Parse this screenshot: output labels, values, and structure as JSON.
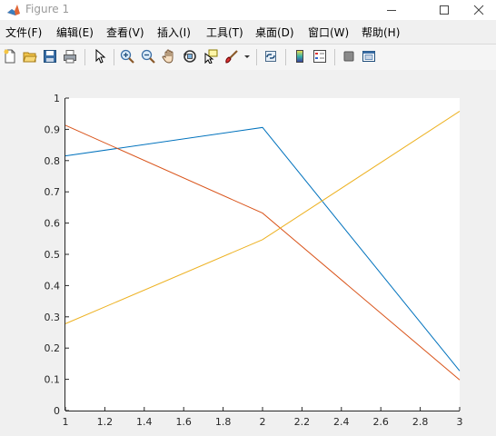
{
  "window": {
    "title": "Figure 1",
    "icon": "matlab-icon"
  },
  "menu": [
    {
      "label": "文件(F)"
    },
    {
      "label": "编辑(E)"
    },
    {
      "label": "查看(V)"
    },
    {
      "label": "插入(I)"
    },
    {
      "label": "工具(T)"
    },
    {
      "label": "桌面(D)"
    },
    {
      "label": "窗口(W)"
    },
    {
      "label": "帮助(H)"
    }
  ],
  "toolbar": [
    "new-figure-icon",
    "open-file-icon",
    "save-icon",
    "print-icon",
    "pointer-icon",
    "zoom-in-icon",
    "zoom-out-icon",
    "pan-icon",
    "rotate-3d-icon",
    "data-cursor-icon",
    "brush-icon",
    "dropdown-arrow-icon",
    "link-plot-icon",
    "colorbar-icon",
    "legend-icon",
    "hide-plot-tools-icon",
    "show-plot-tools-icon"
  ],
  "chart_data": {
    "type": "line",
    "title": "",
    "xlabel": "",
    "ylabel": "",
    "xlim": [
      1,
      3
    ],
    "ylim": [
      0,
      1
    ],
    "xticks": [
      "1",
      "1.2",
      "1.4",
      "1.6",
      "1.8",
      "2",
      "2.2",
      "2.4",
      "2.6",
      "2.8",
      "3"
    ],
    "yticks": [
      "0",
      "0.1",
      "0.2",
      "0.3",
      "0.4",
      "0.5",
      "0.6",
      "0.7",
      "0.8",
      "0.9",
      "1"
    ],
    "x": [
      1,
      2,
      3
    ],
    "series": [
      {
        "values": [
          0.815,
          0.906,
          0.127
        ],
        "color": "#0072BD"
      },
      {
        "values": [
          0.913,
          0.632,
          0.098
        ],
        "color": "#D95319"
      },
      {
        "values": [
          0.278,
          0.547,
          0.958
        ],
        "color": "#EDB120"
      }
    ],
    "grid": false,
    "legend": "none",
    "background": "#ffffff"
  }
}
